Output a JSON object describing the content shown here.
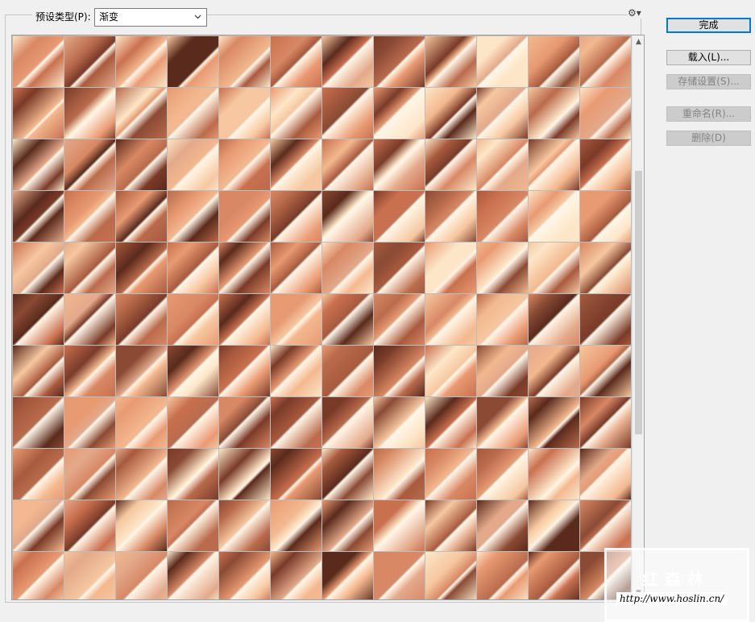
{
  "preset": {
    "label": "预设类型(P):",
    "selected": "渐变"
  },
  "buttons": {
    "done": "完成",
    "load": "载入(L)...",
    "save": "存储设置(S)...",
    "rename": "重命名(R)...",
    "delete": "删除(D)"
  },
  "watermark": {
    "title": "红森林",
    "url": "http://www.hoslin.cn/"
  },
  "icons": {
    "gear": "gear-icon",
    "dropdown": "chevron-down-icon",
    "scroll_up": "arrow-up-icon",
    "scroll_down": "arrow-down-icon"
  },
  "colors": {
    "bg": "#f0f0f0",
    "accent": "#0078d7",
    "palette": [
      "#f6c7a0",
      "#e89a72",
      "#c9704f",
      "#a85a3e",
      "#7a3a28",
      "#fde6c8",
      "#d88864",
      "#b96b4c",
      "#f3b88f",
      "#8a4a34",
      "#e3a98a",
      "#5a2a1c"
    ]
  }
}
